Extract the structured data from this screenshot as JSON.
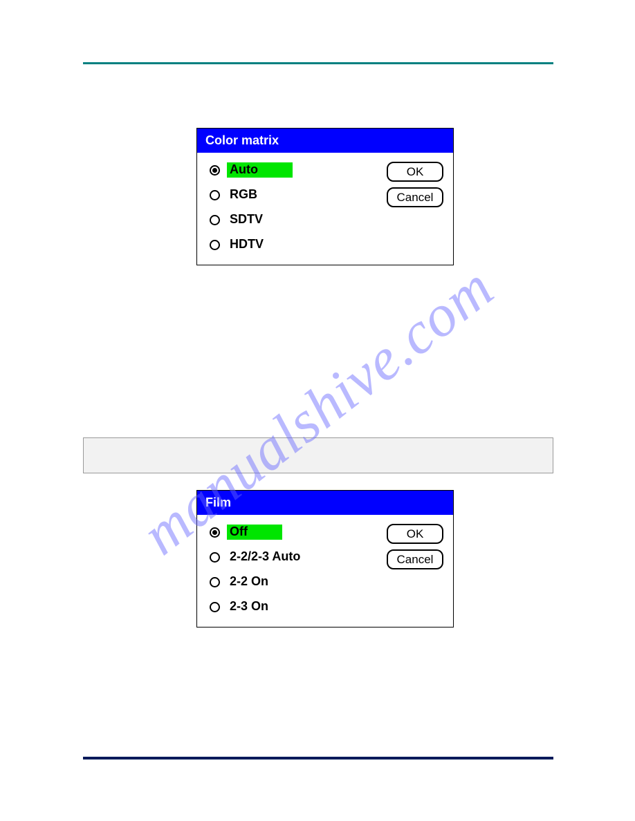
{
  "watermark": "manualshive.com",
  "dialog1": {
    "title": "Color matrix",
    "options": [
      "Auto",
      "RGB",
      "SDTV",
      "HDTV"
    ],
    "selected": 0,
    "ok": "OK",
    "cancel": "Cancel"
  },
  "dialog2": {
    "title": "Film",
    "options": [
      "Off",
      "2-2/2-3 Auto",
      "2-2 On",
      "2-3 On"
    ],
    "selected": 0,
    "ok": "OK",
    "cancel": "Cancel"
  }
}
